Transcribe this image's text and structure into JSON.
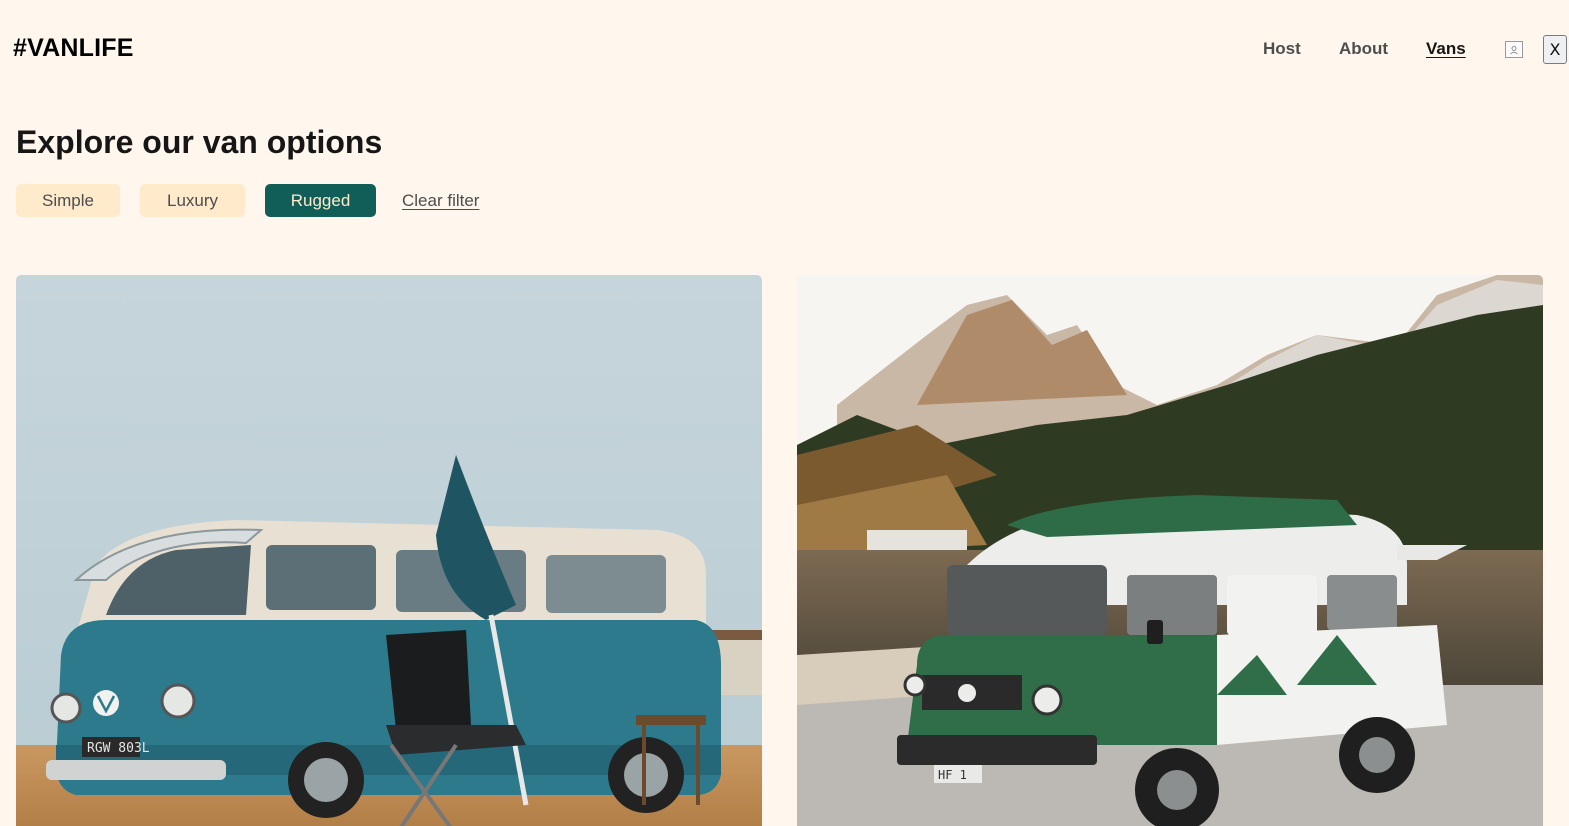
{
  "header": {
    "logo": "#VANLIFE",
    "nav": [
      {
        "label": "Host"
      },
      {
        "label": "About"
      },
      {
        "label": "Vans",
        "active": true
      }
    ],
    "user_icon": "user-circle-icon",
    "close_label": "X"
  },
  "main": {
    "title": "Explore our van options",
    "filters": [
      {
        "label": "Simple",
        "selected": false
      },
      {
        "label": "Luxury",
        "selected": false
      },
      {
        "label": "Rugged",
        "selected": true
      }
    ],
    "clear_filter": "Clear filter",
    "vans": [
      {
        "image": "Blue and white camper van with umbrella and camping chair",
        "plate": "RGW 803L"
      },
      {
        "image": "Green and white camper van by mountain lake",
        "plate": "HF 1"
      }
    ]
  },
  "colors": {
    "background": "#fff7ed",
    "filter_bg": "#ffeacc",
    "rugged_accent": "#115e59",
    "text": "#161616"
  }
}
